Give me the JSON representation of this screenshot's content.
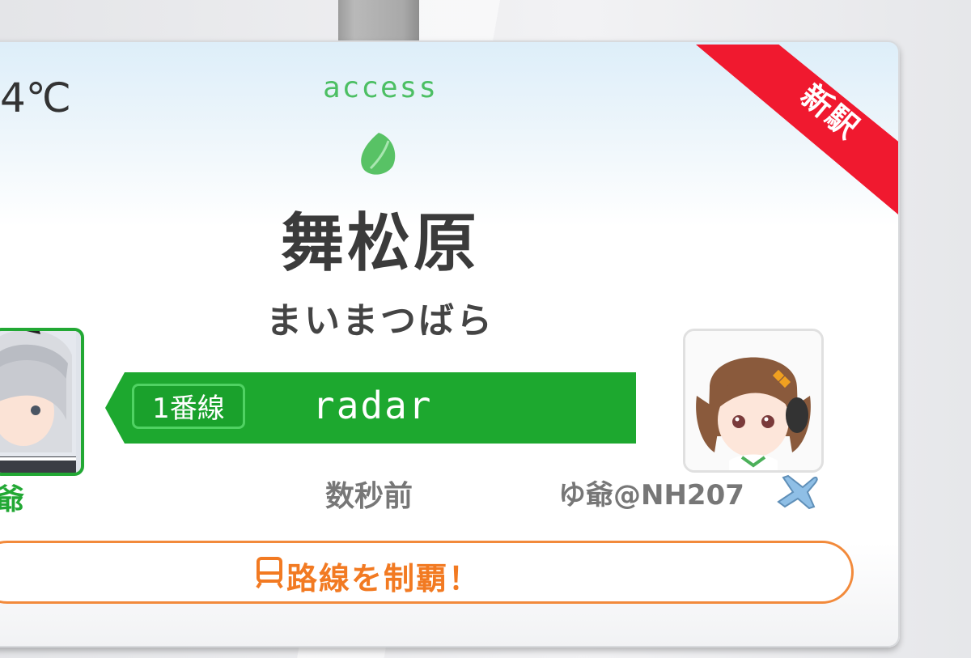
{
  "header": {
    "temperature": "4℃",
    "access_label": "access",
    "new_station_badge": "新駅"
  },
  "station": {
    "name": "舞松原",
    "kana": "まいまつばら"
  },
  "line": {
    "track": "1番線",
    "username": "radar"
  },
  "checkin": {
    "time_ago": "数秒前",
    "by_user": "ゆ爺@NH207",
    "left_user_fragment": "爺"
  },
  "action": {
    "conquer_label": "路線を制覇！"
  },
  "colors": {
    "line_green": "#1da82f",
    "badge_red": "#f0192f",
    "action_orange": "#f27a22"
  }
}
